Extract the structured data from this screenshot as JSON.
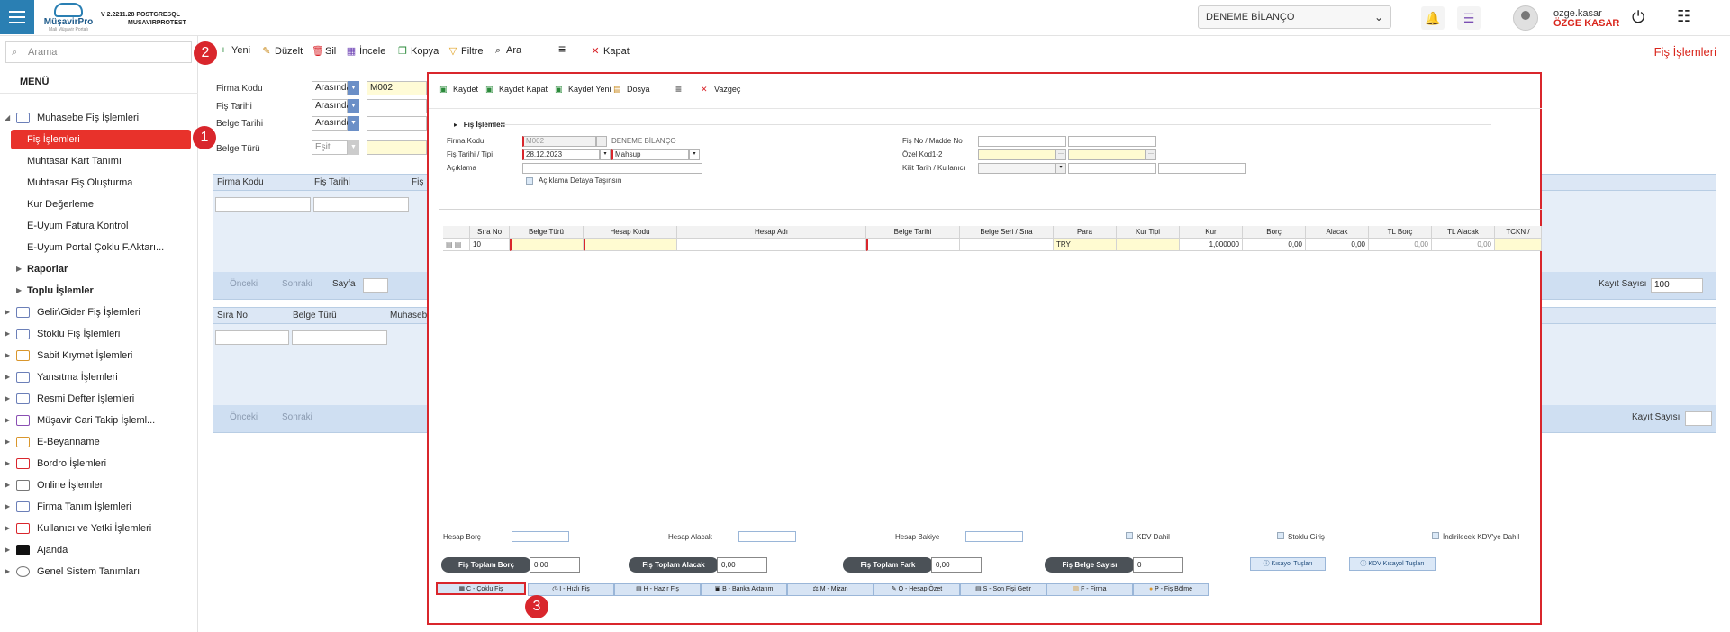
{
  "app": {
    "brand": "MüşavirPro",
    "brand_sub": "Mali Müşavir Portalı",
    "version_line1": "V 2.2211.28 POSTGRESQL",
    "version_line2": "MUSAVIRPROTEST"
  },
  "header": {
    "company": "DENEME BİLANÇO",
    "user_login": "ozge.kasar",
    "user_name": "ÖZGE KASAR"
  },
  "sidebar": {
    "search_placeholder": "Arama",
    "menu_label": "MENÜ",
    "items": [
      {
        "label": "Muhasebe Fiş İşlemleri",
        "level": 0,
        "icon": "ledger-icon"
      },
      {
        "label": "Fiş İşlemleri",
        "level": 1,
        "active": true
      },
      {
        "label": "Muhtasar Kart Tanımı",
        "level": 1
      },
      {
        "label": "Muhtasar Fiş Oluşturma",
        "level": 1
      },
      {
        "label": "Kur Değerleme",
        "level": 1
      },
      {
        "label": "E-Uyum Fatura Kontrol",
        "level": 1
      },
      {
        "label": "E-Uyum Portal Çoklu F.Aktarı...",
        "level": 1
      },
      {
        "label": "Raporlar",
        "level": 1,
        "bold": true
      },
      {
        "label": "Toplu İşlemler",
        "level": 1,
        "bold": true
      },
      {
        "label": "Gelir\\Gider Fiş İşlemleri",
        "level": 0
      },
      {
        "label": "Stoklu Fiş İşlemleri",
        "level": 0
      },
      {
        "label": "Sabit Kıymet İşlemleri",
        "level": 0
      },
      {
        "label": "Yansıtma İşlemleri",
        "level": 0
      },
      {
        "label": "Resmi Defter İşlemleri",
        "level": 0
      },
      {
        "label": "Müşavir Cari Takip İşleml...",
        "level": 0
      },
      {
        "label": "E-Beyanname",
        "level": 0
      },
      {
        "label": "Bordro İşlemleri",
        "level": 0
      },
      {
        "label": "Online İşlemler",
        "level": 0
      },
      {
        "label": "Firma Tanım İşlemleri",
        "level": 0
      },
      {
        "label": "Kullanıcı ve Yetki İşlemleri",
        "level": 0
      },
      {
        "label": "Ajanda",
        "level": 0
      },
      {
        "label": "Genel Sistem Tanımları",
        "level": 0
      }
    ]
  },
  "toolbar": {
    "new": "Yeni",
    "edit": "Düzelt",
    "delete": "Sil",
    "inspect": "İncele",
    "copy": "Kopya",
    "filter": "Filtre",
    "search": "Ara",
    "close": "Kapat",
    "page_title": "Fiş İşlemleri"
  },
  "filter_form": {
    "firma_kodu_label": "Firma Kodu",
    "firma_kodu_op": "Arasında",
    "firma_kodu_value": "M002",
    "fis_tarihi_label": "Fiş Tarihi",
    "fis_tarihi_op": "Arasında",
    "belge_tarihi_label": "Belge Tarihi",
    "belge_tarihi_op": "Arasında",
    "belge_turu_label": "Belge Türü",
    "belge_turu_op": "Eşit"
  },
  "list_grid": {
    "headers": [
      "Firma Kodu",
      "Fiş Tarihi",
      "Fiş"
    ],
    "prev": "Önceki",
    "next": "Sonraki",
    "page_label": "Sayfa",
    "record_count_label": "Kayıt Sayısı",
    "record_count": "100"
  },
  "detail_list_grid": {
    "headers": [
      "Sıra No",
      "Belge Türü",
      "Muhaseb"
    ],
    "prev": "Önceki",
    "next": "Sonraki",
    "record_count_label": "Kayıt Sayısı"
  },
  "modal": {
    "toolbar": {
      "save": "Kaydet",
      "save_close": "Kaydet Kapat",
      "save_new": "Kaydet Yeni",
      "file": "Dosya",
      "cancel": "Vazgeç"
    },
    "section_title": "Fiş İşlemleri",
    "firma_kodu_label": "Firma Kodu",
    "firma_kodu_value": "M002",
    "firma_name": "DENEME BİLANÇO",
    "fis_tarihi_label": "Fiş Tarihi / Tipi",
    "fis_tarihi_value": "28.12.2023",
    "fis_tipi_value": "Mahsup",
    "aciklama_label": "Açıklama",
    "aciklama_checkbox": "Açıklama Detaya Taşınsın",
    "fis_no_label": "Fiş No / Madde No",
    "ozel_kod_label": "Özel Kod1-2",
    "kilit_label": "Kilit Tarih / Kullanıcı",
    "grid_headers": [
      "Sıra No",
      "Belge Türü",
      "Hesap Kodu",
      "Hesap Adı",
      "Belge Tarihi",
      "Belge Seri / Sıra",
      "Para",
      "Kur Tipi",
      "Kur",
      "Borç",
      "Alacak",
      "TL Borç",
      "TL Alacak",
      "TCKN /"
    ],
    "grid_row": [
      "10",
      "",
      "",
      "",
      "",
      "",
      "TRY",
      "",
      "1,000000",
      "0,00",
      "0,00",
      "0,00",
      "0,00",
      ""
    ],
    "hesap_borc_label": "Hesap Borç",
    "hesap_alacak_label": "Hesap Alacak",
    "hesap_bakiye_label": "Hesap Bakiye",
    "kdv_dahil_label": "KDV Dahil",
    "stoklu_giris_label": "Stoklu Giriş",
    "indirilecek_label": "İndirilecek KDV'ye Dahil",
    "totals": [
      {
        "label": "Fiş Toplam Borç",
        "value": "0,00"
      },
      {
        "label": "Fiş Toplam Alacak",
        "value": "0,00"
      },
      {
        "label": "Fiş Toplam Fark",
        "value": "0,00"
      },
      {
        "label": "Fiş Belge Sayısı",
        "value": "0"
      }
    ],
    "shortcut_keys": "Kısayol Tuşları",
    "kdv_shortcut_keys": "KDV Kısayol Tuşları",
    "actions": [
      "C - Çoklu Fiş",
      "I - Hızlı Fiş",
      "H - Hazır Fiş",
      "B - Banka Aktarım",
      "M - Mizan",
      "O - Hesap Özet",
      "S - Son Fişi Getir",
      "F - Firma",
      "P - Fiş Bölme"
    ]
  },
  "annotations": [
    "1",
    "2",
    "3"
  ],
  "colors": {
    "accent_red": "#d9262c",
    "menu_blue": "#2a7fb3",
    "grid_blue": "#cfdff2"
  }
}
